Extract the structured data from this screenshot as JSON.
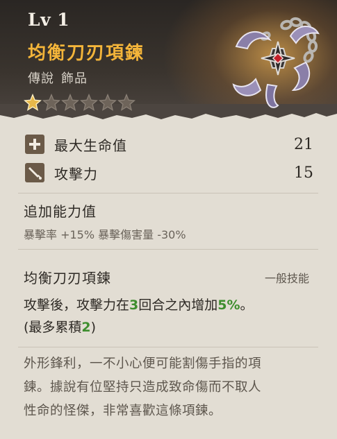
{
  "header": {
    "level": "Lv 1",
    "item_name": "均衡刀刃項鍊",
    "rarity": "傳說",
    "category": "飾品",
    "stars_filled": 1,
    "stars_total": 6
  },
  "stats": [
    {
      "icon": "plus-icon",
      "label": "最大生命值",
      "value": "21"
    },
    {
      "icon": "sword-icon",
      "label": "攻擊力",
      "value": "15"
    }
  ],
  "bonus": {
    "title": "追加能力值",
    "text": "暴擊率 +15% 暴擊傷害量 -30%"
  },
  "skill": {
    "name": "均衡刀刃項鍊",
    "type": "一般技能",
    "desc_part1": "攻擊後，攻擊力在",
    "turns": "3",
    "desc_part2": "回合之內增加",
    "percent": "5%",
    "desc_part3": "。",
    "desc_line2_a": "(最多累積",
    "max_stack": "2",
    "desc_line2_b": ")"
  },
  "lore": {
    "line1": "外形鋒利，一不小心便可能割傷手指的項",
    "line2": "鍊。據說有位堅持只造成致命傷而不取人",
    "line3": "性命的怪傑，非常喜歡這條項鍊。"
  },
  "colors": {
    "title": "#f4b53a",
    "star_filled": "#e7b84a",
    "star_empty": "#6e645a",
    "highlight": "#3e8e2e"
  }
}
